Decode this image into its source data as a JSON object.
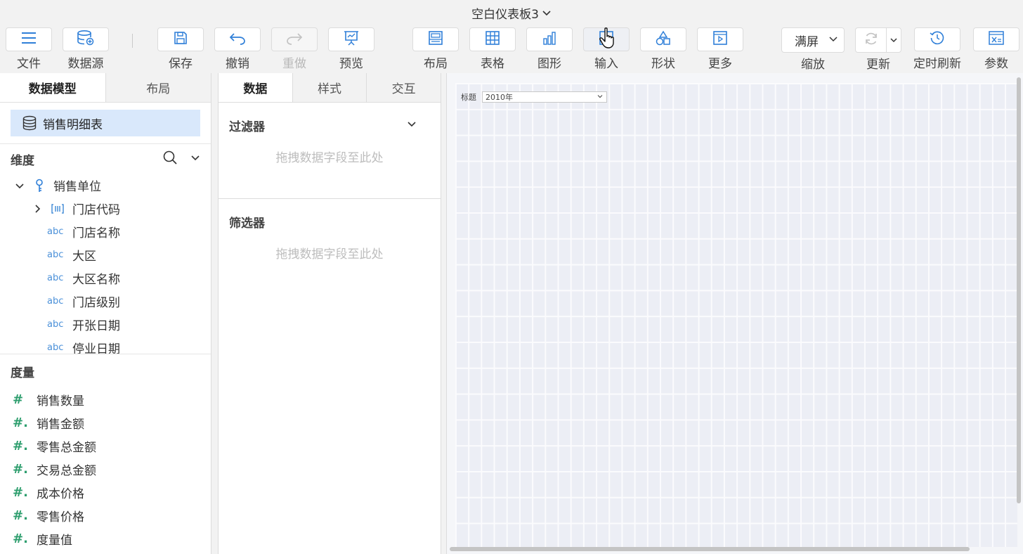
{
  "title": "空白仪表板3",
  "toolbar": {
    "file": "文件",
    "datasource": "数据源",
    "save": "保存",
    "undo": "撤销",
    "redo": "重做",
    "preview": "预览",
    "layout": "布局",
    "table": "表格",
    "chart": "图形",
    "input": "输入",
    "shape": "形状",
    "more": "更多",
    "zoom_value": "满屏",
    "zoom": "缩放",
    "refresh": "更新",
    "timed_refresh": "定时刷新",
    "params": "参数"
  },
  "left_panel": {
    "tabs": [
      "数据模型",
      "布局"
    ],
    "model_item": "销售明细表",
    "dimensions_title": "维度",
    "dimensions": [
      {
        "label": "销售单位"
      },
      {
        "label": "门店代码"
      },
      {
        "label": "门店名称",
        "type": "abc"
      },
      {
        "label": "大区",
        "type": "abc"
      },
      {
        "label": "大区名称",
        "type": "abc"
      },
      {
        "label": "门店级别",
        "type": "abc"
      },
      {
        "label": "开张日期",
        "type": "abc"
      },
      {
        "label": "停业日期",
        "type": "abc"
      }
    ],
    "measures_title": "度量",
    "measures": [
      {
        "label": "销售数量",
        "icon": "#"
      },
      {
        "label": "销售金额",
        "icon": "#."
      },
      {
        "label": "零售总金额",
        "icon": "#."
      },
      {
        "label": "交易总金额",
        "icon": "#."
      },
      {
        "label": "成本价格",
        "icon": "#."
      },
      {
        "label": "零售价格",
        "icon": "#."
      },
      {
        "label": "度量值",
        "icon": "#."
      }
    ]
  },
  "mid_panel": {
    "tabs": [
      "数据",
      "样式",
      "交互"
    ],
    "filter_title": "过滤器",
    "filter_placeholder": "拖拽数据字段至此处",
    "screener_title": "筛选器",
    "screener_placeholder": "拖拽数据字段至此处"
  },
  "canvas": {
    "widget_label": "标题",
    "widget_value": "2010年"
  },
  "colors": {
    "accent": "#2f7fd8",
    "model_highlight": "#d9e8fb",
    "measure_icon": "#2e9e6e"
  }
}
